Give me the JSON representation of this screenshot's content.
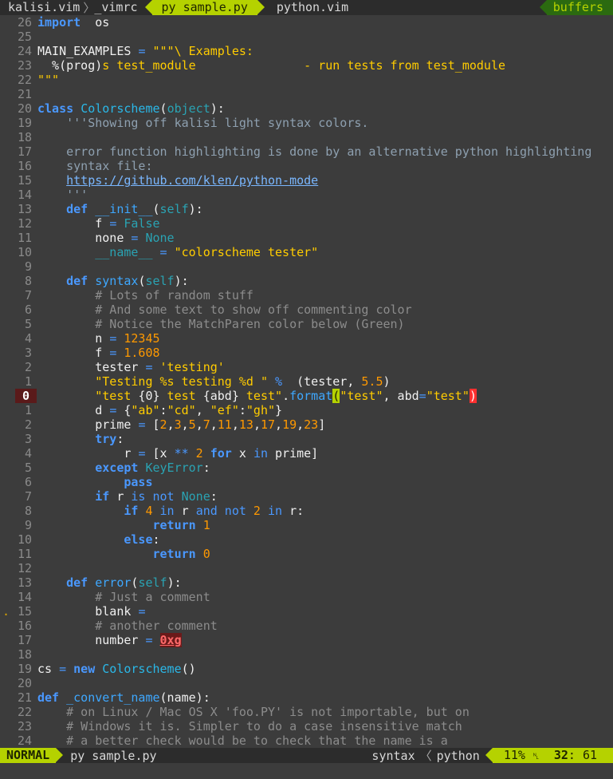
{
  "tabline": {
    "tabs": [
      "kalisi.vim",
      "_vimrc",
      "py sample.py",
      "python.vim"
    ],
    "separator": "〉",
    "right": "buffers"
  },
  "gutter": [
    "26",
    "25",
    "24",
    "23",
    "22",
    "21",
    "20",
    "19",
    "18",
    "17",
    "16",
    "15",
    "14",
    "13",
    "12",
    "11",
    "10",
    "9",
    "8",
    "7",
    "6",
    "5",
    "4",
    "3",
    "2",
    "1",
    "0",
    "1",
    "2",
    "3",
    "4",
    "5",
    "6",
    "7",
    "8",
    "9",
    "10",
    "11",
    "12",
    "13",
    "14",
    "15",
    "16",
    "17",
    "18",
    "19",
    "20",
    "21",
    "22",
    "23",
    "24"
  ],
  "sign_mark": ".",
  "code": [
    [
      [
        "k",
        "import"
      ],
      [
        "",
        "  os"
      ]
    ],
    [],
    [
      [
        "",
        "MAIN_EXAMPLES "
      ],
      [
        "o",
        "="
      ],
      [
        "s",
        " \"\"\"\\ Examples:"
      ]
    ],
    [
      [
        "",
        "  %(prog)"
      ],
      [
        "s",
        "s test_module               - run tests from test_module"
      ]
    ],
    [
      [
        "s",
        "\"\"\""
      ]
    ],
    [],
    [
      [
        "k",
        "class "
      ],
      [
        "cls",
        "Colorscheme"
      ],
      [
        "",
        "("
      ],
      [
        "b",
        "object"
      ],
      [
        "",
        "):"
      ]
    ],
    [
      [
        "doc",
        "    '''Showing off kalisi light syntax colors."
      ]
    ],
    [],
    [
      [
        "doc",
        "    error function highlighting is done by an alternative python highlighting"
      ]
    ],
    [
      [
        "doc",
        "    syntax file:"
      ]
    ],
    [
      [
        "",
        "    "
      ],
      [
        "u",
        "https://github.com/klen/python-mode"
      ]
    ],
    [
      [
        "doc",
        "    '''"
      ]
    ],
    [
      [
        "k",
        "    def "
      ],
      [
        "f",
        "__init__"
      ],
      [
        "",
        "("
      ],
      [
        "b",
        "self"
      ],
      [
        "",
        "):"
      ]
    ],
    [
      [
        "",
        "        f "
      ],
      [
        "o",
        "="
      ],
      [
        "b",
        " False"
      ]
    ],
    [
      [
        "",
        "        none "
      ],
      [
        "o",
        "="
      ],
      [
        "b",
        " None"
      ]
    ],
    [
      [
        "b",
        "        __name__"
      ],
      [
        "o",
        " ="
      ],
      [
        "s",
        " \"colorscheme tester\""
      ]
    ],
    [],
    [
      [
        "k",
        "    def "
      ],
      [
        "f",
        "syntax"
      ],
      [
        "",
        "("
      ],
      [
        "b",
        "self"
      ],
      [
        "",
        "):"
      ]
    ],
    [
      [
        "c",
        "        # Lots of random stuff"
      ]
    ],
    [
      [
        "c",
        "        # And some text to show off commenting color"
      ]
    ],
    [
      [
        "c",
        "        # Notice the MatchParen color below (Green)"
      ]
    ],
    [
      [
        "",
        "        n "
      ],
      [
        "o",
        "="
      ],
      [
        "n",
        " 12345"
      ]
    ],
    [
      [
        "",
        "        f "
      ],
      [
        "o",
        "="
      ],
      [
        "n",
        " 1.608"
      ]
    ],
    [
      [
        "",
        "        tester "
      ],
      [
        "o",
        "="
      ],
      [
        "s",
        " 'testing'"
      ]
    ],
    [
      [
        "s",
        "        \"Testing %s testing %d \""
      ],
      [
        "o",
        " %"
      ],
      [
        "",
        "  (tester, "
      ],
      [
        "n",
        "5.5"
      ],
      [
        "",
        ")"
      ]
    ],
    [
      [
        "s",
        "        \"test "
      ],
      [
        "",
        "{0}"
      ],
      [
        "s",
        " test "
      ],
      [
        "",
        "{abd}"
      ],
      [
        "s",
        " test\""
      ],
      [
        "",
        ".",
        ""
      ],
      [
        "f",
        "format"
      ],
      [
        "mp1",
        "("
      ],
      [
        "s",
        "\"test\""
      ],
      [
        "",
        ", abd"
      ],
      [
        "o",
        "="
      ],
      [
        "s",
        "\"test\""
      ],
      [
        "mp2",
        ")"
      ]
    ],
    [
      [
        "",
        "        d "
      ],
      [
        "o",
        "="
      ],
      [
        "",
        " {"
      ],
      [
        "s",
        "\"ab\""
      ],
      [
        "",
        ":"
      ],
      [
        "s",
        "\"cd\""
      ],
      [
        "",
        ", "
      ],
      [
        "s",
        "\"ef\""
      ],
      [
        "",
        ":"
      ],
      [
        "s",
        "\"gh\""
      ],
      [
        "",
        "}"
      ]
    ],
    [
      [
        "",
        "        prime "
      ],
      [
        "o",
        "="
      ],
      [
        "",
        " ["
      ],
      [
        "n",
        "2"
      ],
      [
        "",
        ","
      ],
      [
        "n",
        "3"
      ],
      [
        "",
        ","
      ],
      [
        "n",
        "5"
      ],
      [
        "",
        ","
      ],
      [
        "n",
        "7"
      ],
      [
        "",
        ","
      ],
      [
        "n",
        "11"
      ],
      [
        "",
        ","
      ],
      [
        "n",
        "13"
      ],
      [
        "",
        ","
      ],
      [
        "n",
        "17"
      ],
      [
        "",
        ","
      ],
      [
        "n",
        "19"
      ],
      [
        "",
        ","
      ],
      [
        "n",
        "23"
      ],
      [
        "",
        "]"
      ]
    ],
    [
      [
        "k",
        "        try"
      ],
      [
        "",
        ":"
      ]
    ],
    [
      [
        "",
        "            r "
      ],
      [
        "o",
        "="
      ],
      [
        "",
        " [x "
      ],
      [
        "o",
        "**"
      ],
      [
        "n",
        " 2"
      ],
      [
        "k",
        " for"
      ],
      [
        "",
        " x "
      ],
      [
        "o",
        "in"
      ],
      [
        "",
        " prime]"
      ]
    ],
    [
      [
        "k",
        "        except "
      ],
      [
        "b",
        "KeyError"
      ],
      [
        "",
        ":"
      ]
    ],
    [
      [
        "k",
        "            pass"
      ]
    ],
    [
      [
        "k",
        "        if"
      ],
      [
        "",
        " r "
      ],
      [
        "o",
        "is not"
      ],
      [
        "b",
        " None"
      ],
      [
        "",
        ":"
      ]
    ],
    [
      [
        "k",
        "            if"
      ],
      [
        "n",
        " 4"
      ],
      [
        "o",
        " in"
      ],
      [
        "",
        " r "
      ],
      [
        "o",
        "and not"
      ],
      [
        "n",
        " 2"
      ],
      [
        "o",
        " in"
      ],
      [
        "",
        " r:"
      ]
    ],
    [
      [
        "k",
        "                return"
      ],
      [
        "n",
        " 1"
      ]
    ],
    [
      [
        "k",
        "            else"
      ],
      [
        "",
        ":"
      ]
    ],
    [
      [
        "k",
        "                return"
      ],
      [
        "n",
        " 0"
      ]
    ],
    [],
    [
      [
        "k",
        "    def "
      ],
      [
        "f",
        "error"
      ],
      [
        "",
        "("
      ],
      [
        "b",
        "self"
      ],
      [
        "",
        "):"
      ]
    ],
    [
      [
        "c",
        "        # Just a comment"
      ]
    ],
    [
      [
        "",
        "        blank "
      ],
      [
        "o",
        "="
      ]
    ],
    [
      [
        "c",
        "        # another comment"
      ]
    ],
    [
      [
        "",
        "        number "
      ],
      [
        "o",
        "="
      ],
      [
        "",
        " "
      ],
      [
        "err",
        "0xg"
      ]
    ],
    [],
    [
      [
        "",
        "cs "
      ],
      [
        "o",
        "="
      ],
      [
        "k",
        " new "
      ],
      [
        "cls",
        "Colorscheme"
      ],
      [
        "",
        "()"
      ]
    ],
    [],
    [
      [
        "k",
        "def "
      ],
      [
        "f",
        "_convert_name"
      ],
      [
        "",
        "(name):"
      ]
    ],
    [
      [
        "c",
        "    # on Linux / Mac OS X 'foo.PY' is not importable, but on"
      ]
    ],
    [
      [
        "c",
        "    # Windows it is. Simpler to do a case insensitive match"
      ]
    ],
    [
      [
        "c",
        "    # a better check would be to check that the name is a"
      ]
    ]
  ],
  "statusline": {
    "mode": "NORMAL",
    "file": "py sample.py",
    "syntax": "syntax",
    "angle": "〈",
    "filetype": "python",
    "percent": "11%",
    "line_icon": "␤",
    "line": "32",
    "col": "61"
  }
}
